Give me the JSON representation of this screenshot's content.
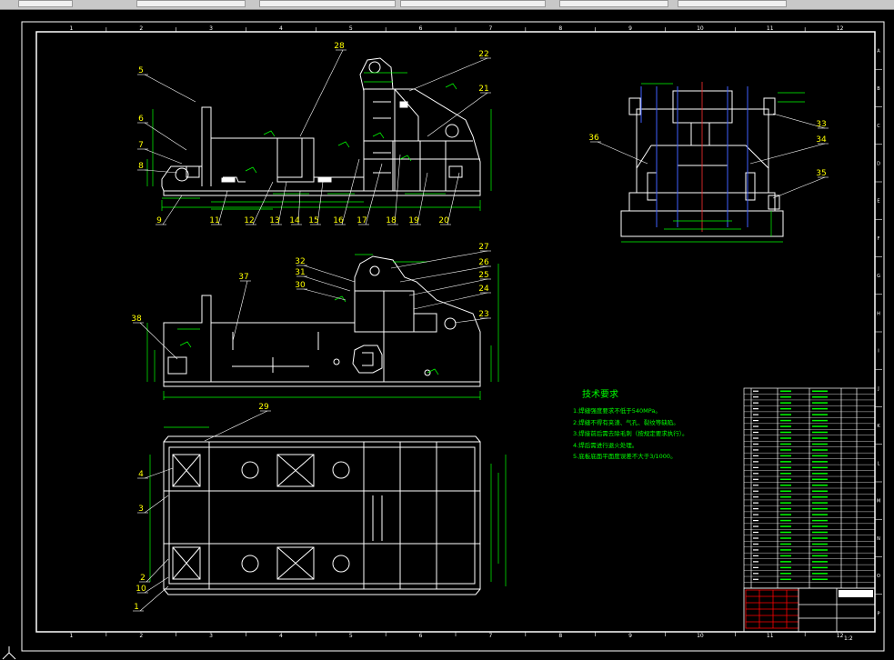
{
  "toolbar": {
    "fields": [
      "",
      "",
      "",
      "",
      "",
      ""
    ]
  },
  "frame": {
    "col_labels": [
      "1",
      "2",
      "3",
      "4",
      "5",
      "6",
      "7",
      "8",
      "9",
      "10",
      "11",
      "12"
    ],
    "row_labels": [
      "A",
      "B",
      "C",
      "D",
      "E",
      "F",
      "G",
      "H",
      "I",
      "J",
      "K",
      "L",
      "M",
      "N",
      "O",
      "P"
    ]
  },
  "callouts": {
    "view1": [
      "5",
      "6",
      "7",
      "8",
      "9",
      "11",
      "12",
      "13",
      "14",
      "15",
      "16",
      "17",
      "18",
      "19",
      "20",
      "21",
      "22",
      "28"
    ],
    "view_side": [
      "33",
      "34",
      "35",
      "36"
    ],
    "view2": [
      "23",
      "24",
      "25",
      "26",
      "27",
      "30",
      "31",
      "32",
      "37",
      "38"
    ],
    "view3": [
      "1",
      "2",
      "3",
      "4",
      "10",
      "29"
    ]
  },
  "tech": {
    "title": "技术要求",
    "items": [
      "1.焊缝强度要求不低于540MPa。",
      "2.焊缝不得有夹渣、气孔、裂纹等缺陷。",
      "3.焊接前后需去除毛刺（按规定要求执行）。",
      "4.焊后需进行退火处理。",
      "5.底板底面平面度误差不大于3/1000。"
    ]
  },
  "title_block": {
    "scale": "1:2"
  },
  "colors": {
    "background": "#000000",
    "lines": "#ffffff",
    "dims": "#00ff00",
    "callouts": "#ffff00",
    "hidden": "#4060ff",
    "center": "#ff2020",
    "title_block_red": "#ff0000"
  }
}
